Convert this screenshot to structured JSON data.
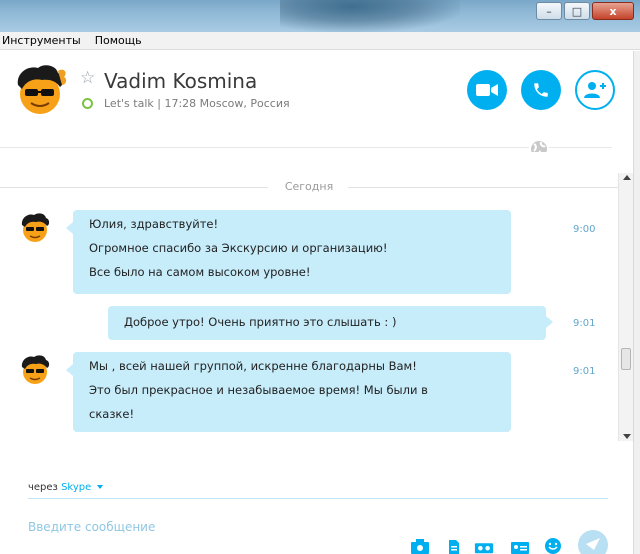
{
  "menu": {
    "items": [
      "Инструменты",
      "Помощь"
    ]
  },
  "window_controls": {
    "minimize": "–",
    "maximize": "□",
    "close": "x"
  },
  "contact": {
    "name": "Vadim Kosmina",
    "status_text": "Let's talk  |  17:28 Moscow, Россия"
  },
  "chat": {
    "day_separator": "Сегодня",
    "messages": [
      {
        "direction": "incoming",
        "lines": [
          "Юлия, здравствуйте!",
          "Огромное спасибо за  Экскурсию и организацию!",
          "Все было на самом высоком уровне!"
        ],
        "time": "9:00"
      },
      {
        "direction": "outgoing",
        "lines": [
          "Доброе утро! Очень приятно это слышать : )"
        ],
        "time": "9:01"
      },
      {
        "direction": "incoming",
        "lines": [
          "Мы , всей нашей группой, искренне благодарны Вам!",
          "Это был  прекрасное и незабываемое время! Мы были  в",
          "сказке!"
        ],
        "time": "9:01"
      }
    ]
  },
  "composer": {
    "via_label": "через",
    "via_link": "Skype",
    "placeholder": "Введите сообщение"
  },
  "colors": {
    "accent": "#00aff0",
    "bubble": "#c7ecfa",
    "status_online": "#7cc242"
  }
}
